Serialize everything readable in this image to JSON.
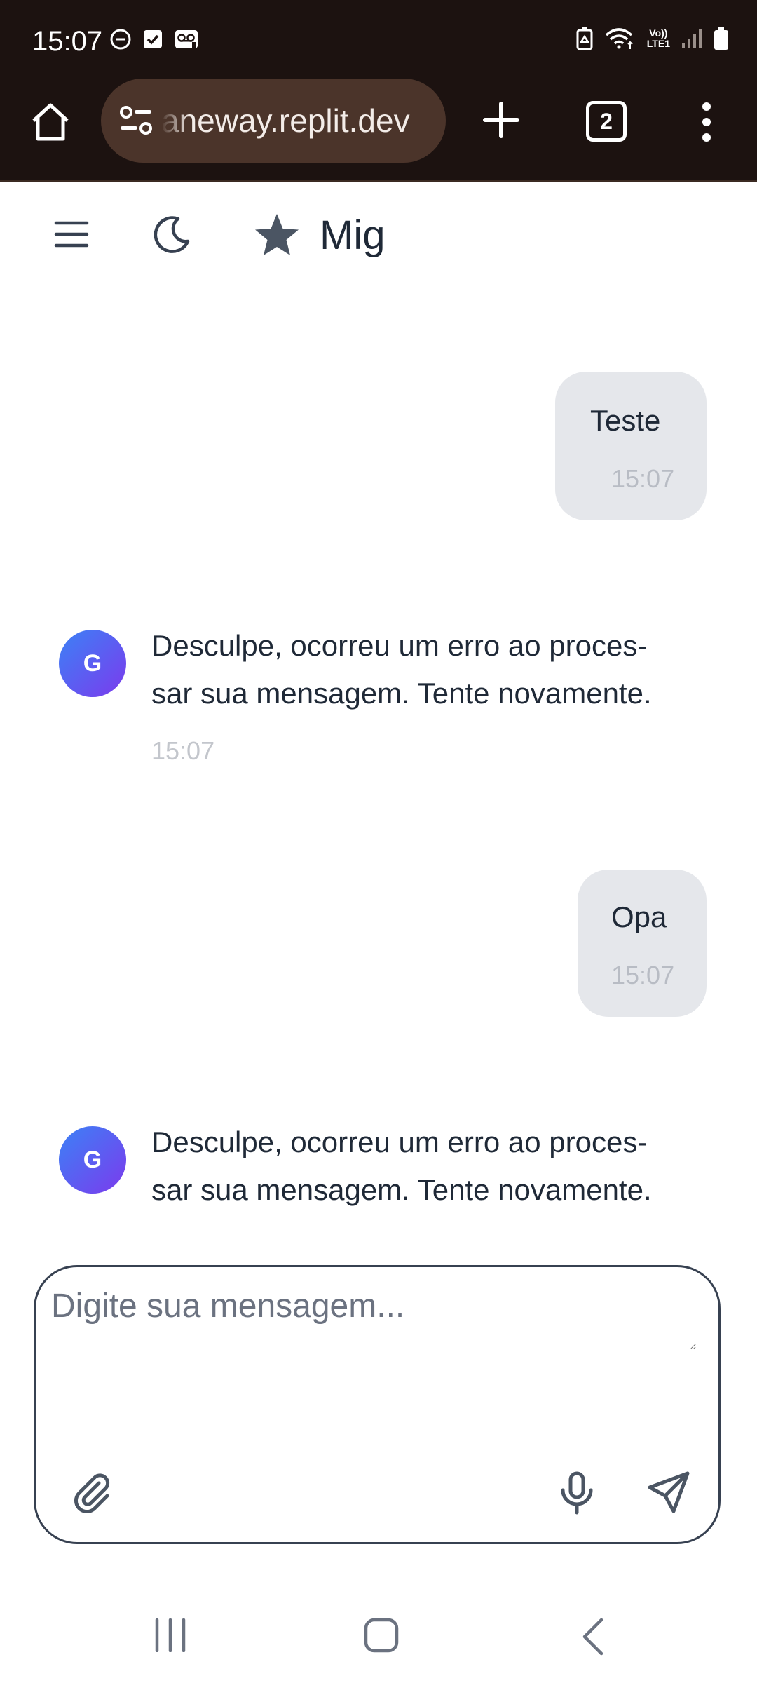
{
  "status_bar": {
    "time": "15:07",
    "volte_label_top": "Vo))",
    "volte_label_bottom": "LTE1",
    "left_icons": [
      "do-not-disturb-icon",
      "checkbox-icon",
      "voicemail-icon"
    ],
    "right_icons": [
      "battery-saver-icon",
      "wifi-icon",
      "volte-icon",
      "signal-icon",
      "battery-icon"
    ]
  },
  "browser": {
    "url_text": "aneway.replit.dev",
    "tab_count": "2"
  },
  "app": {
    "title": "Mig"
  },
  "messages": [
    {
      "role": "user",
      "text": "Teste",
      "time": "15:07"
    },
    {
      "role": "assistant",
      "avatar": "G",
      "text_line1": "Desculpe, ocorreu um erro ao proces-",
      "text_line2": "sar sua mensagem. Tente novamente.",
      "time": "15:07"
    },
    {
      "role": "user",
      "text": "Opa",
      "time": "15:07"
    },
    {
      "role": "assistant",
      "avatar": "G",
      "text_line1": "Desculpe, ocorreu um erro ao proces-",
      "text_line2": "sar sua mensagem. Tente novamente."
    }
  ],
  "composer": {
    "placeholder": "Digite sua mensagem..."
  },
  "colors": {
    "browser_chrome": "#1c1210",
    "urlbar": "#4b342a",
    "user_bubble": "#e5e7eb",
    "avatar_gradient_start": "#3b82f6",
    "avatar_gradient_end": "#7c3aed",
    "icon_gray": "#4b5563"
  }
}
